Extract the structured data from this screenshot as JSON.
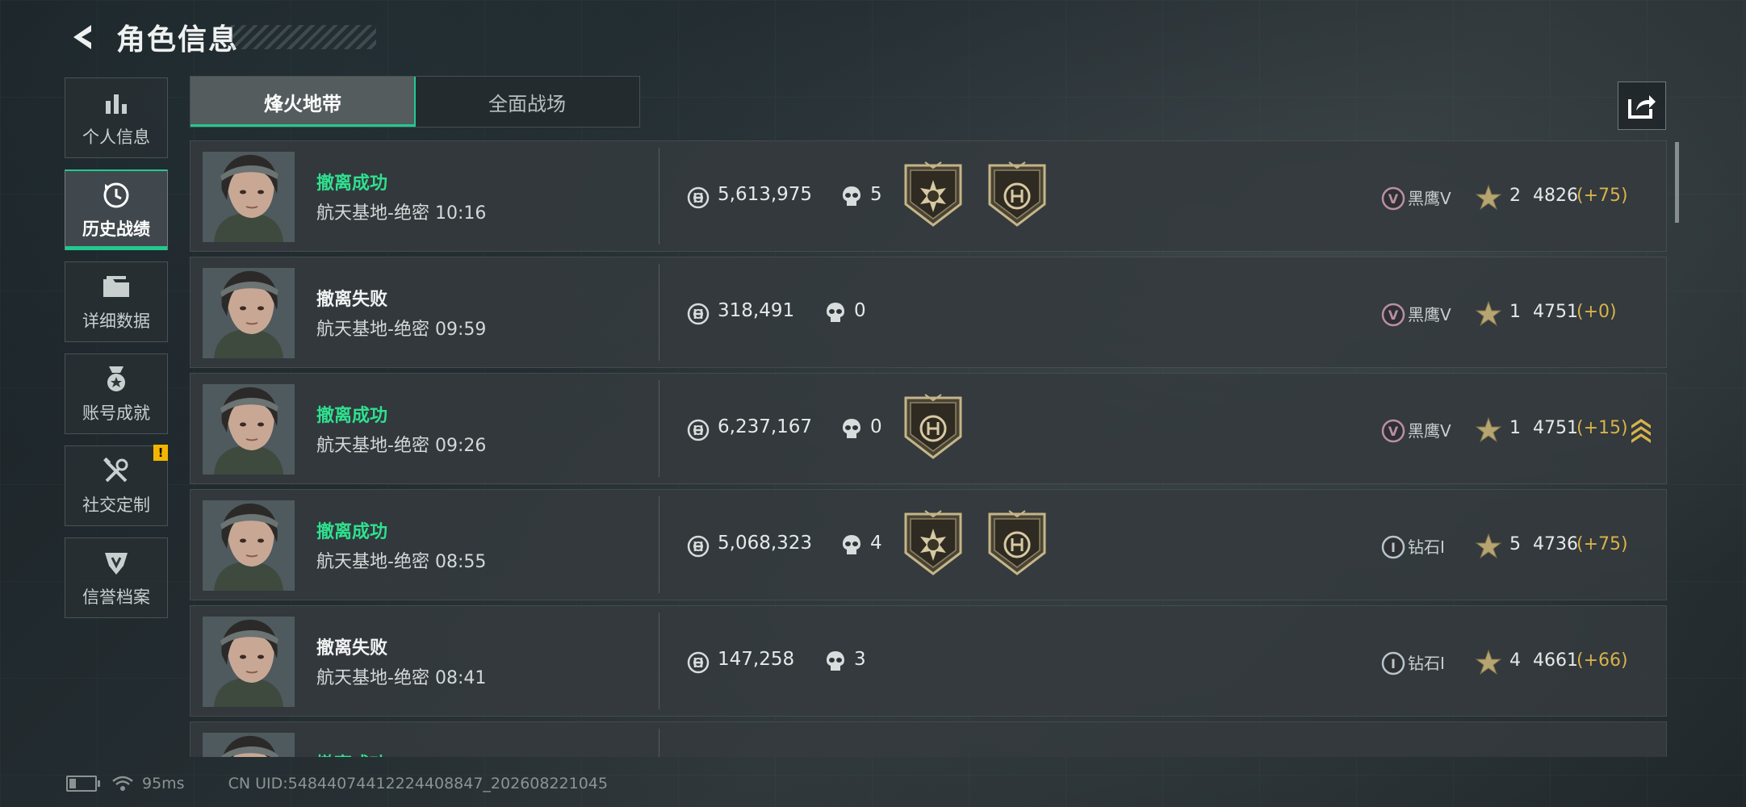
{
  "header": {
    "title": "角色信息",
    "back_icon": "back-arrow-icon"
  },
  "sidebar": {
    "items": [
      {
        "label": "个人信息",
        "icon": "bar-chart-icon",
        "active": false
      },
      {
        "label": "历史战绩",
        "icon": "history-clock-icon",
        "active": true
      },
      {
        "label": "详细数据",
        "icon": "folder-icon",
        "active": false
      },
      {
        "label": "账号成就",
        "icon": "achievement-medal-icon",
        "active": false
      },
      {
        "label": "社交定制",
        "icon": "tools-icon",
        "active": false,
        "badge": "!"
      },
      {
        "label": "信誉档案",
        "icon": "credit-shield-icon",
        "active": false
      }
    ]
  },
  "tabs": [
    {
      "label": "烽火地带",
      "active": true
    },
    {
      "label": "全面战场",
      "active": false
    }
  ],
  "share_icon": "share-icon",
  "records": [
    {
      "result": "撤离成功",
      "status": "success",
      "map": "航天基地-绝密",
      "time": "10:16",
      "coins": "5,613,975",
      "kills": "5",
      "medals": [
        "kill-medal-icon",
        "coin-medal-icon"
      ],
      "rank_icon": "rank-v-icon",
      "rank": "黑鹰V",
      "stars": "2",
      "score": "4826",
      "delta": "(+75)",
      "rankup": false
    },
    {
      "result": "撤离失败",
      "status": "fail",
      "map": "航天基地-绝密",
      "time": "09:59",
      "coins": "318,491",
      "kills": "0",
      "medals": [],
      "rank_icon": "rank-v-icon",
      "rank": "黑鹰V",
      "stars": "1",
      "score": "4751",
      "delta": "(+0)",
      "rankup": false
    },
    {
      "result": "撤离成功",
      "status": "success",
      "map": "航天基地-绝密",
      "time": "09:26",
      "coins": "6,237,167",
      "kills": "0",
      "medals": [
        "coin-medal-icon"
      ],
      "rank_icon": "rank-v-icon",
      "rank": "黑鹰V",
      "stars": "1",
      "score": "4751",
      "delta": "(+15)",
      "rankup": true
    },
    {
      "result": "撤离成功",
      "status": "success",
      "map": "航天基地-绝密",
      "time": "08:55",
      "coins": "5,068,323",
      "kills": "4",
      "medals": [
        "kill-medal-icon",
        "coin-medal-icon"
      ],
      "rank_icon": "rank-i-icon",
      "rank": "钻石I",
      "stars": "5",
      "score": "4736",
      "delta": "(+75)",
      "rankup": false
    },
    {
      "result": "撤离失败",
      "status": "fail",
      "map": "航天基地-绝密",
      "time": "08:41",
      "coins": "147,258",
      "kills": "3",
      "medals": [],
      "rank_icon": "rank-i-icon",
      "rank": "钻石I",
      "stars": "4",
      "score": "4661",
      "delta": "(+66)",
      "rankup": false
    },
    {
      "result": "撤离成功",
      "status": "success",
      "map": "",
      "time": "",
      "coins": "",
      "kills": "",
      "medals": [],
      "rank_icon": "",
      "rank": "",
      "stars": "",
      "score": "",
      "delta": "",
      "rankup": false,
      "partial": true
    }
  ],
  "footer": {
    "ping": "95ms",
    "uid": "CN UID:54844074412224408847_202608221045"
  },
  "colors": {
    "accent": "#22c98e",
    "success": "#2fe08f",
    "delta": "#d8b24a",
    "warning": "#f2b600"
  }
}
